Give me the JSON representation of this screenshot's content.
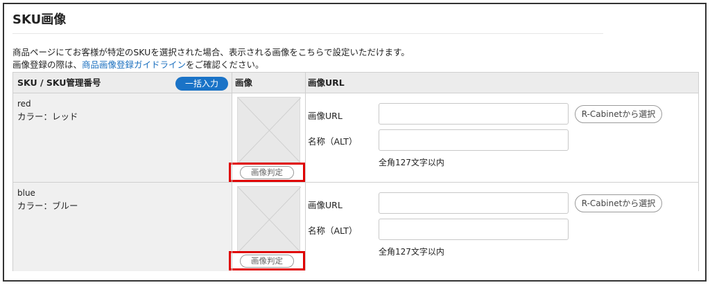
{
  "section": {
    "title": "SKU画像",
    "description_line1": "商品ページにてお客様が特定のSKUを選択された場合、表示される画像をこちらで設定いただけます。",
    "description_line2_prefix": "画像登録の際は、",
    "description_line2_link": "商品画像登録ガイドライン",
    "description_line2_suffix": "をご確認ください。"
  },
  "table": {
    "headers": {
      "sku": "SKU / SKU管理番号",
      "image": "画像",
      "image_url": "画像URL"
    },
    "bulk_button": "一括入力",
    "rows": [
      {
        "sku_code": "red",
        "attribute": "カラー：レッド",
        "judge_button": "画像判定",
        "url_label": "画像URL",
        "url_value": "",
        "alt_label": "名称（ALT）",
        "alt_value": "",
        "cabinet_button": "R-Cabinetから選択",
        "hint": "全角127文字以内"
      },
      {
        "sku_code": "blue",
        "attribute": "カラー：ブルー",
        "judge_button": "画像判定",
        "url_label": "画像URL",
        "url_value": "",
        "alt_label": "名称（ALT）",
        "alt_value": "",
        "cabinet_button": "R-Cabinetから選択",
        "hint": "全角127文字以内"
      }
    ]
  },
  "colors": {
    "accent_button": "#1a73c7",
    "link": "#1a6fbf",
    "highlight": "#e00000",
    "header_bg": "#ececec",
    "sku_cell_bg": "#f0f0f0"
  }
}
